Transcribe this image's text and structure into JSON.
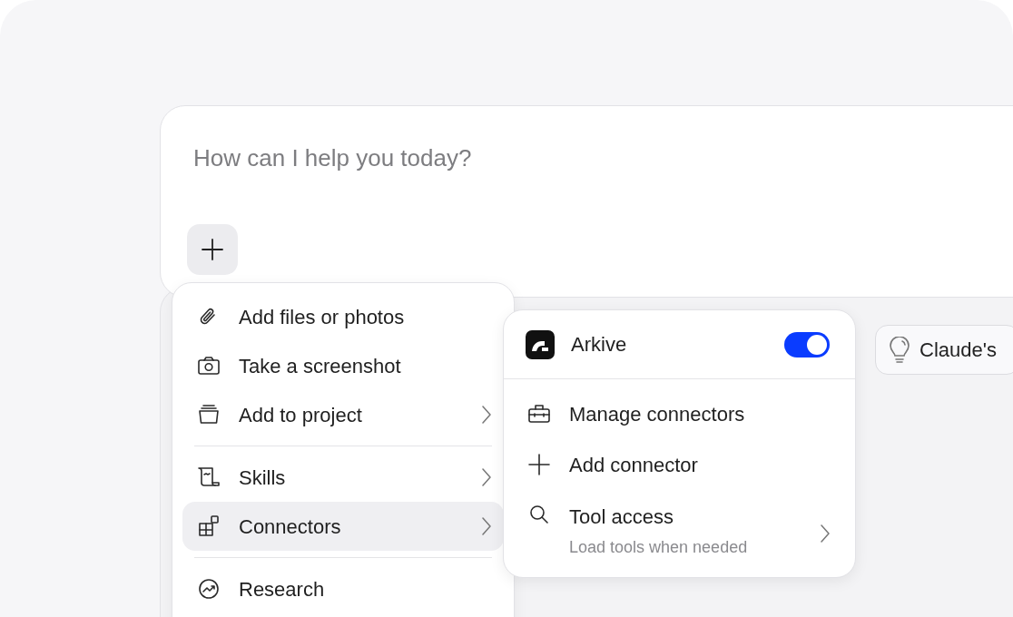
{
  "composer": {
    "placeholder": "How can I help you today?"
  },
  "chips": [
    {
      "label": "Claude's"
    }
  ],
  "menu": {
    "groups": [
      [
        {
          "kind": "paperclip",
          "label": "Add files or photos",
          "submenu": false,
          "selected": false
        },
        {
          "kind": "camera",
          "label": "Take a screenshot",
          "submenu": false,
          "selected": false
        },
        {
          "kind": "project",
          "label": "Add to project",
          "submenu": true,
          "selected": false
        }
      ],
      [
        {
          "kind": "scroll",
          "label": "Skills",
          "submenu": true,
          "selected": false
        },
        {
          "kind": "blocks",
          "label": "Connectors",
          "submenu": true,
          "selected": true
        }
      ],
      [
        {
          "kind": "research",
          "label": "Research",
          "submenu": false,
          "selected": false
        }
      ]
    ]
  },
  "submenu": {
    "connector": {
      "label": "Arkive",
      "on": true
    },
    "items": [
      {
        "kind": "toolbox",
        "label": "Manage connectors",
        "submenu": false
      },
      {
        "kind": "plus",
        "label": "Add connector",
        "submenu": false
      },
      {
        "kind": "search",
        "label": "Tool access",
        "subtitle": "Load tools when needed",
        "submenu": true
      }
    ]
  }
}
